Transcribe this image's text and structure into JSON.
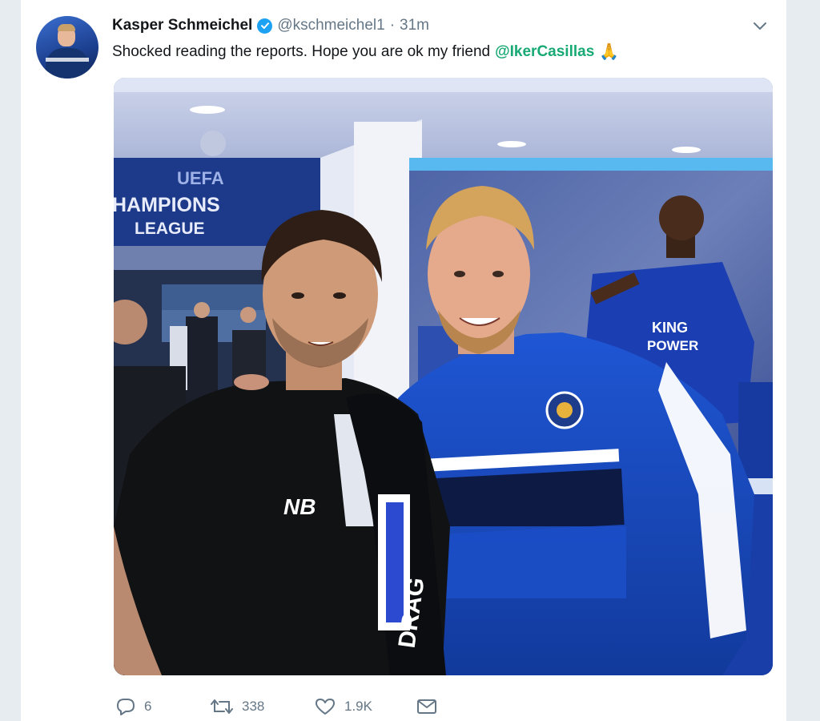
{
  "tweet": {
    "author_name": "Kasper Schmeichel",
    "handle": "@kschmeichel1",
    "separator": "·",
    "time": "31m",
    "text_before": "Shocked reading the reports. Hope you are ok my friend",
    "mention": "@IkerCasillas",
    "emoji": "🙏",
    "avatar_icon": "user-avatar",
    "verified_icon": "verified-badge-icon",
    "accent": "#1da1f2",
    "mention_color": "#19a974"
  },
  "media": {
    "sign_line1": "UEFA",
    "sign_line2": "HAMPIONS",
    "sign_line3": "LEAGUE",
    "poster_text_1": "KING",
    "poster_text_2": "POWER",
    "shirt_brand": "NB",
    "scarf_text": "DRAG"
  },
  "actions": {
    "reply_count": "6",
    "retweet_count": "338",
    "like_count": "1.9K",
    "reply_icon": "reply-icon",
    "retweet_icon": "retweet-icon",
    "like_icon": "heart-icon",
    "dm_icon": "direct-message-icon"
  }
}
